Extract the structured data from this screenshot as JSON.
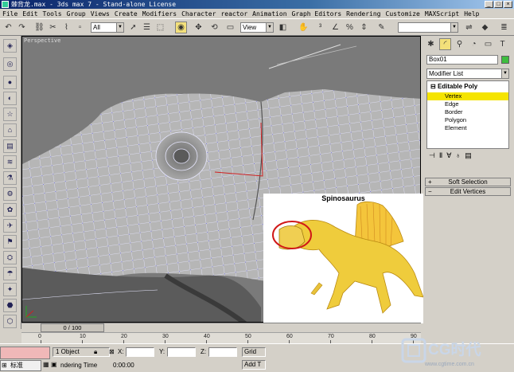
{
  "window": {
    "title": "棘背龙.max - 3ds max 7  - Stand-alone License"
  },
  "menu": [
    "File",
    "Edit",
    "Tools",
    "Group",
    "Views",
    "Create",
    "Modifiers",
    "Character",
    "reactor",
    "Animation",
    "Graph Editors",
    "Rendering",
    "Customize",
    "MAXScript",
    "Help"
  ],
  "toolbar": {
    "selection_filter": "All",
    "reference_coord": "View",
    "named_selection": ""
  },
  "viewport": {
    "label": "Perspective"
  },
  "command_panel": {
    "object_name": "Box01",
    "object_color": "#3ebd3e",
    "modifier_list": "Modifier List",
    "stack_title": "Editable Poly",
    "stack_items": [
      {
        "label": "Vertex",
        "selected": true
      },
      {
        "label": "Edge",
        "selected": false
      },
      {
        "label": "Border",
        "selected": false
      },
      {
        "label": "Polygon",
        "selected": false
      },
      {
        "label": "Element",
        "selected": false
      }
    ],
    "rollouts": [
      "Soft Selection",
      "Edit Vertices"
    ]
  },
  "reference_image": {
    "title": "Spinosaurus"
  },
  "time": {
    "frame_display": "0 / 100",
    "ticks": [
      "0",
      "10",
      "20",
      "30",
      "40",
      "50",
      "60",
      "70",
      "80",
      "90"
    ]
  },
  "status": {
    "selection": "1 Object",
    "x_label": "X:",
    "y_label": "Y:",
    "z_label": "Z:",
    "grid_label": "Grid",
    "prompt_prefix": "标准",
    "prompt_text": "ndering Time",
    "render_time": "0:00:00",
    "add_label": "Add T"
  },
  "watermark": {
    "brand": "CG时代",
    "url": "www.cgtime.com.cn"
  }
}
